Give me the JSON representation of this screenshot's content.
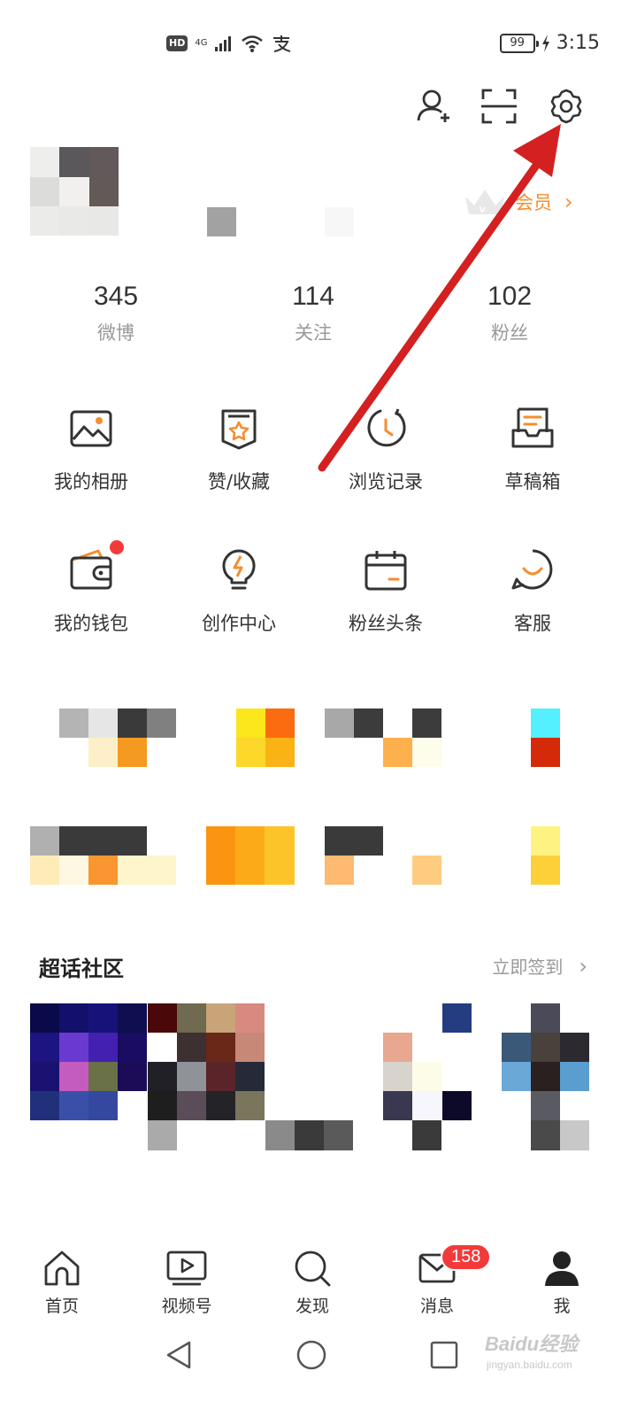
{
  "status_bar": {
    "hd_badge": "HD",
    "network_type": "4G",
    "battery_level": "99",
    "time": "3:15"
  },
  "top_actions": {
    "icons": [
      "add-friend-icon",
      "scan-icon",
      "settings-icon"
    ]
  },
  "profile": {
    "vip_label": "会员",
    "vip_chevron": "›"
  },
  "stats": [
    {
      "value": "345",
      "label": "微博"
    },
    {
      "value": "114",
      "label": "关注"
    },
    {
      "value": "102",
      "label": "粉丝"
    }
  ],
  "features": [
    {
      "label": "我的相册",
      "icon": "photo-album-icon"
    },
    {
      "label": "赞/收藏",
      "icon": "favorites-icon"
    },
    {
      "label": "浏览记录",
      "icon": "history-icon"
    },
    {
      "label": "草稿箱",
      "icon": "drafts-icon"
    },
    {
      "label": "我的钱包",
      "icon": "wallet-icon"
    },
    {
      "label": "创作中心",
      "icon": "creator-center-icon"
    },
    {
      "label": "粉丝头条",
      "icon": "fan-headlines-icon"
    },
    {
      "label": "客服",
      "icon": "customer-service-icon"
    }
  ],
  "supertopic": {
    "title": "超话社区",
    "checkin_label": "立即签到",
    "checkin_chevron": "›"
  },
  "bottom_nav": [
    {
      "label": "首页",
      "icon": "home-icon"
    },
    {
      "label": "视频号",
      "icon": "video-icon"
    },
    {
      "label": "发现",
      "icon": "discover-icon"
    },
    {
      "label": "消息",
      "icon": "message-icon"
    },
    {
      "label": "我",
      "icon": "profile-icon"
    }
  ],
  "message_badge": "158",
  "watermark": {
    "brand": "Baidu经验",
    "url": "jingyan.baidu.com"
  },
  "colors": {
    "accent": "#f68d2e",
    "badge_red": "#f33a3a",
    "annotation_arrow": "#d42020"
  }
}
